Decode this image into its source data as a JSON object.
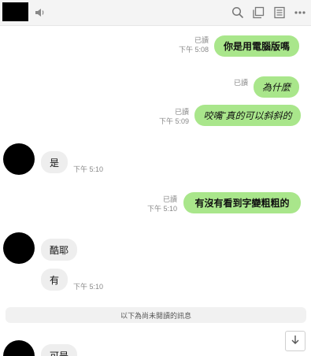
{
  "header": {
    "icons": [
      "speaker-icon",
      "search-icon",
      "copy-icon",
      "note-icon",
      "more-icon"
    ]
  },
  "messages": {
    "m1": {
      "text": "你是用電腦版嗎",
      "read": "已讀",
      "time": "下午 5:08"
    },
    "m2": {
      "text": "為什麼",
      "read": "已讀"
    },
    "m3": {
      "text": "咬嘴˜真的可以斜斜的",
      "read": "已讀",
      "time": "下午 5:09"
    },
    "m4": {
      "text": "是",
      "time": "下午 5:10"
    },
    "m5": {
      "text": "有沒有看到字變粗粗的",
      "read": "已讀",
      "time": "下午 5:10"
    },
    "m6": {
      "text": "酷耶"
    },
    "m7": {
      "text": "有",
      "time": "下午 5:10"
    },
    "m8": {
      "text": "可是"
    }
  },
  "divider": {
    "text": "以下為尚未閱讀的訊息"
  },
  "colors": {
    "outgoing_bubble": "#a9e68b",
    "incoming_bubble": "#eeeeee",
    "header_bg": "#f4f4f4"
  }
}
